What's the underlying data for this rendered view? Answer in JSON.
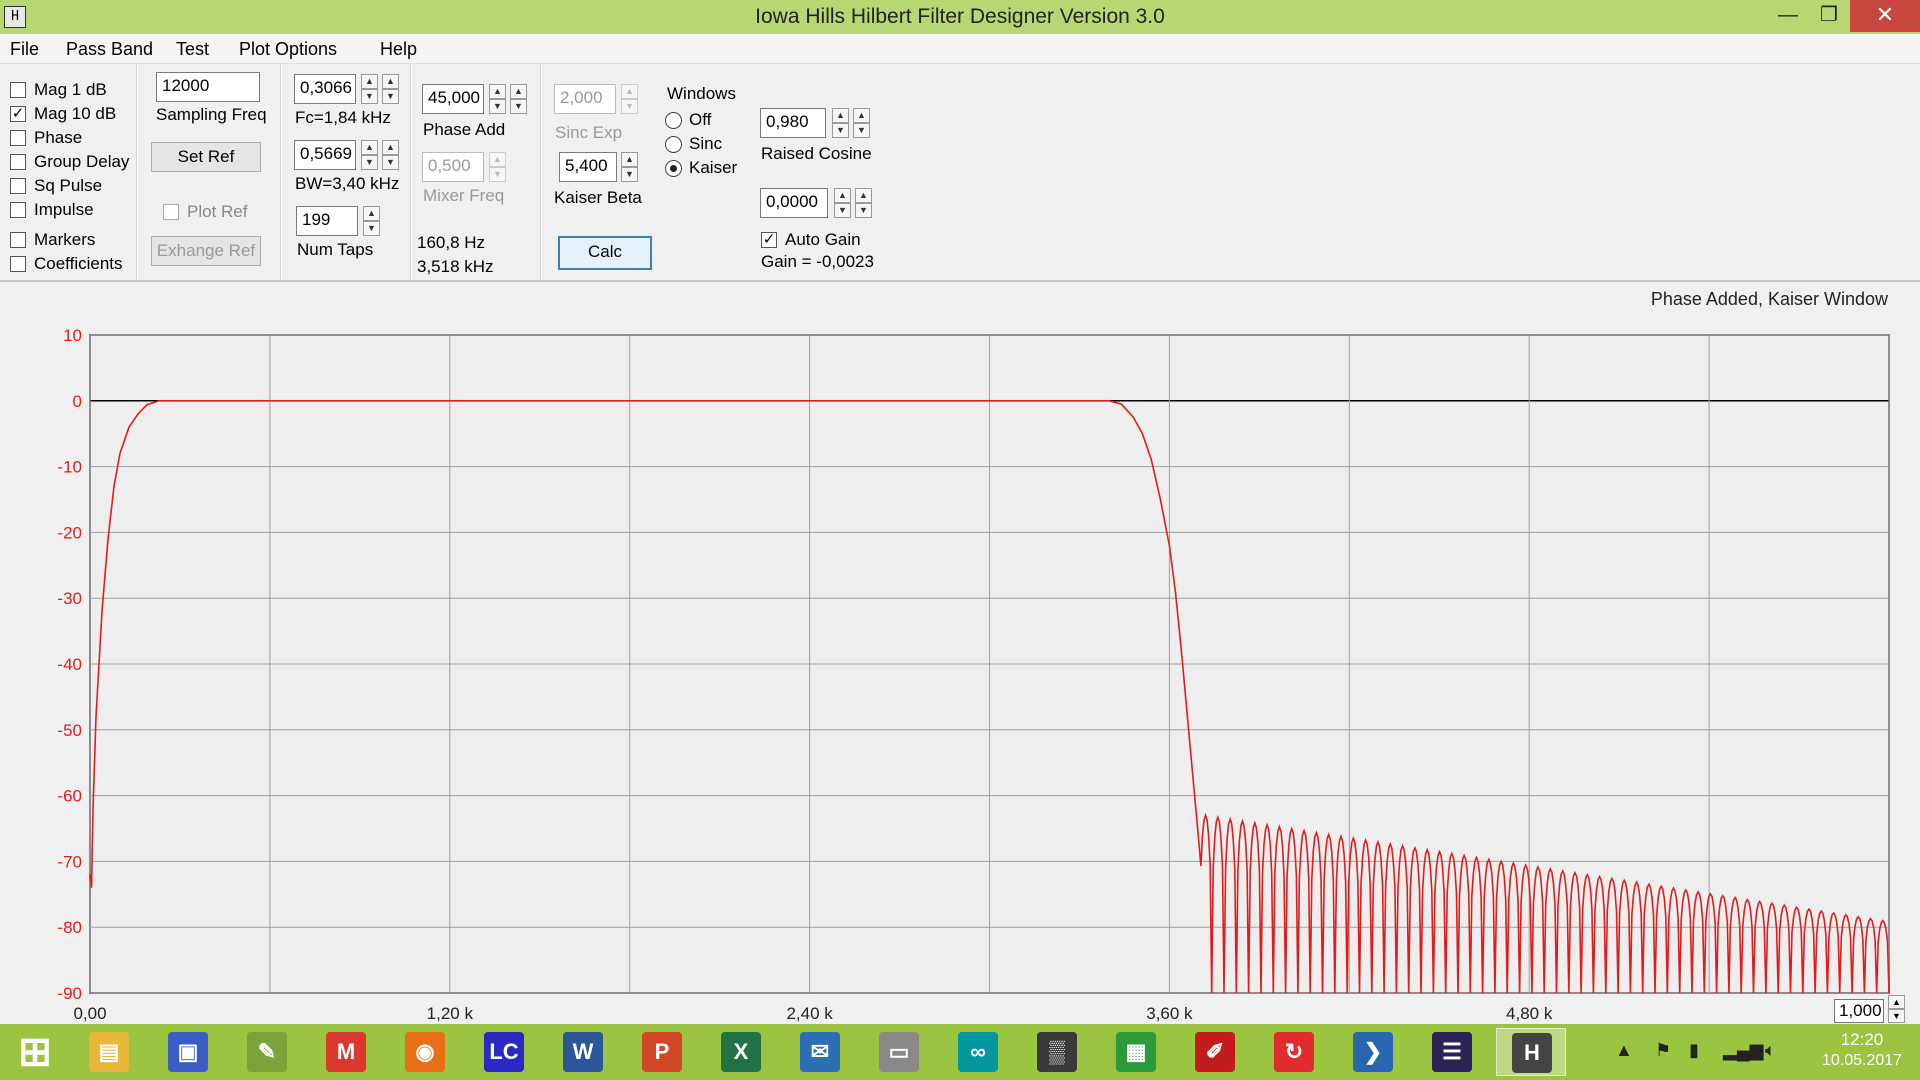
{
  "window": {
    "title": "Iowa Hills Hilbert Filter Designer  Version 3.0",
    "min_glyph": "—",
    "max_glyph": "❐",
    "close_glyph": "✕",
    "app_icon_glyph": "H"
  },
  "menu": {
    "items": [
      "File",
      "Pass Band",
      "Test",
      "Plot Options",
      "Help"
    ]
  },
  "checkboxes": [
    {
      "label": "Mag   1 dB",
      "checked": false
    },
    {
      "label": "Mag 10 dB",
      "checked": true
    },
    {
      "label": "Phase",
      "checked": false
    },
    {
      "label": "Group Delay",
      "checked": false
    },
    {
      "label": "Sq Pulse",
      "checked": false
    },
    {
      "label": "Impulse",
      "checked": false
    },
    {
      "label": "Markers",
      "checked": false
    },
    {
      "label": "Coefficients",
      "checked": false
    }
  ],
  "sampling": {
    "value": "12000",
    "label": "Sampling Freq",
    "set_ref": "Set Ref",
    "plot_ref": "Plot Ref",
    "exchange_ref": "Exhange Ref"
  },
  "fc": {
    "value": "0,3066",
    "label": "Fc=1,84 kHz"
  },
  "bw": {
    "value": "0,5669",
    "label": "BW=3,40 kHz"
  },
  "taps": {
    "value": "199",
    "label": "Num Taps"
  },
  "phase_add": {
    "value": "45,000",
    "label": "Phase Add"
  },
  "mixer": {
    "value": "0,500",
    "label": "Mixer Freq",
    "readout1": "160,8 Hz",
    "readout2": "3,518 kHz"
  },
  "sinc_exp": {
    "value": "2,000",
    "label": "Sinc Exp"
  },
  "kaiser_beta": {
    "value": "5,400",
    "label": "Kaiser Beta"
  },
  "calc": "Calc",
  "windows": {
    "title": "Windows",
    "options": [
      {
        "label": "Off",
        "selected": false
      },
      {
        "label": "Sinc",
        "selected": false
      },
      {
        "label": "Kaiser",
        "selected": true
      }
    ]
  },
  "raised_cosine": {
    "value": "0,980",
    "label": "Raised Cosine"
  },
  "gain_field": {
    "value": "0,0000"
  },
  "auto_gain": {
    "label": "Auto Gain",
    "checked": true,
    "gain_text": "Gain = -0,0023"
  },
  "chart_caption": "Phase Added, Kaiser Window",
  "zoom": {
    "value": "1,000"
  },
  "chart_data": {
    "type": "line",
    "title": "Phase Added, Kaiser Window",
    "xlabel": "",
    "ylabel": "",
    "xlim": [
      0,
      6000
    ],
    "ylim": [
      -90,
      10
    ],
    "x_tick_labels": [
      {
        "x": 0,
        "label": "0,00"
      },
      {
        "x": 1200,
        "label": "1,20 k"
      },
      {
        "x": 2400,
        "label": "2,40 k"
      },
      {
        "x": 3600,
        "label": "3,60 k"
      },
      {
        "x": 4800,
        "label": "4,80 k"
      }
    ],
    "x_gridlines": [
      0,
      600,
      1200,
      1800,
      2400,
      3000,
      3600,
      4200,
      4800,
      5400,
      6000
    ],
    "y_ticks": [
      10,
      0,
      -10,
      -20,
      -30,
      -40,
      -50,
      -60,
      -70,
      -80,
      -90
    ],
    "grid": true,
    "line_color": "#e21b1b",
    "zero_line_color": "#000000",
    "series": [
      {
        "points": [
          [
            0,
            -72
          ],
          [
            5,
            -74
          ],
          [
            10,
            -62
          ],
          [
            20,
            -48
          ],
          [
            40,
            -32
          ],
          [
            60,
            -21
          ],
          [
            80,
            -13
          ],
          [
            100,
            -8
          ],
          [
            130,
            -4
          ],
          [
            160,
            -2
          ],
          [
            190,
            -0.6
          ],
          [
            230,
            0
          ],
          [
            400,
            0
          ],
          [
            1000,
            0
          ],
          [
            2000,
            0
          ],
          [
            3000,
            0
          ],
          [
            3400,
            0
          ],
          [
            3440,
            -0.5
          ],
          [
            3480,
            -2.5
          ],
          [
            3510,
            -5
          ],
          [
            3540,
            -9
          ],
          [
            3570,
            -15
          ],
          [
            3600,
            -22
          ],
          [
            3620,
            -29
          ],
          [
            3640,
            -38
          ],
          [
            3660,
            -48
          ],
          [
            3680,
            -58
          ],
          [
            3700,
            -68
          ]
        ],
        "stopband": {
          "x_start": 3700,
          "x_end": 6000,
          "ripple_count": 56,
          "peak_start": -63,
          "peak_end": -79,
          "floor": -90
        }
      }
    ]
  },
  "taskbar": {
    "apps": [
      {
        "name": "windows-start",
        "glyph": "⊞",
        "color": "#ffffff"
      },
      {
        "name": "file-explorer",
        "glyph": "▤",
        "color": "#e8b73a"
      },
      {
        "name": "save-disk",
        "glyph": "▣",
        "color": "#3b5cc4"
      },
      {
        "name": "notepad",
        "glyph": "✎",
        "color": "#7aa33b"
      },
      {
        "name": "gmail",
        "glyph": "M",
        "color": "#d93a2d"
      },
      {
        "name": "firefox",
        "glyph": "◉",
        "color": "#e86f16"
      },
      {
        "name": "lc-calc",
        "glyph": "LC",
        "color": "#2a2ac2"
      },
      {
        "name": "word",
        "glyph": "W",
        "color": "#2b579a"
      },
      {
        "name": "powerpoint",
        "glyph": "P",
        "color": "#d24726"
      },
      {
        "name": "excel",
        "glyph": "X",
        "color": "#217346"
      },
      {
        "name": "thunderbird",
        "glyph": "✉",
        "color": "#2d6fb3"
      },
      {
        "name": "drive",
        "glyph": "▭",
        "color": "#888888"
      },
      {
        "name": "arduino",
        "glyph": "∞",
        "color": "#00979d"
      },
      {
        "name": "board",
        "glyph": "▒",
        "color": "#3a3a3a"
      },
      {
        "name": "calculator",
        "glyph": "▦",
        "color": "#2a9a3a"
      },
      {
        "name": "acrobat",
        "glyph": "✐",
        "color": "#c21c1c"
      },
      {
        "name": "red-app",
        "glyph": "↻",
        "color": "#e02c2c"
      },
      {
        "name": "powershell",
        "glyph": "❯",
        "color": "#2a66b0"
      },
      {
        "name": "eclipse",
        "glyph": "☰",
        "color": "#2c2255"
      },
      {
        "name": "hilbert-app",
        "glyph": "H",
        "color": "#444444"
      }
    ],
    "time": "12:20",
    "date": "10.05.2017"
  }
}
